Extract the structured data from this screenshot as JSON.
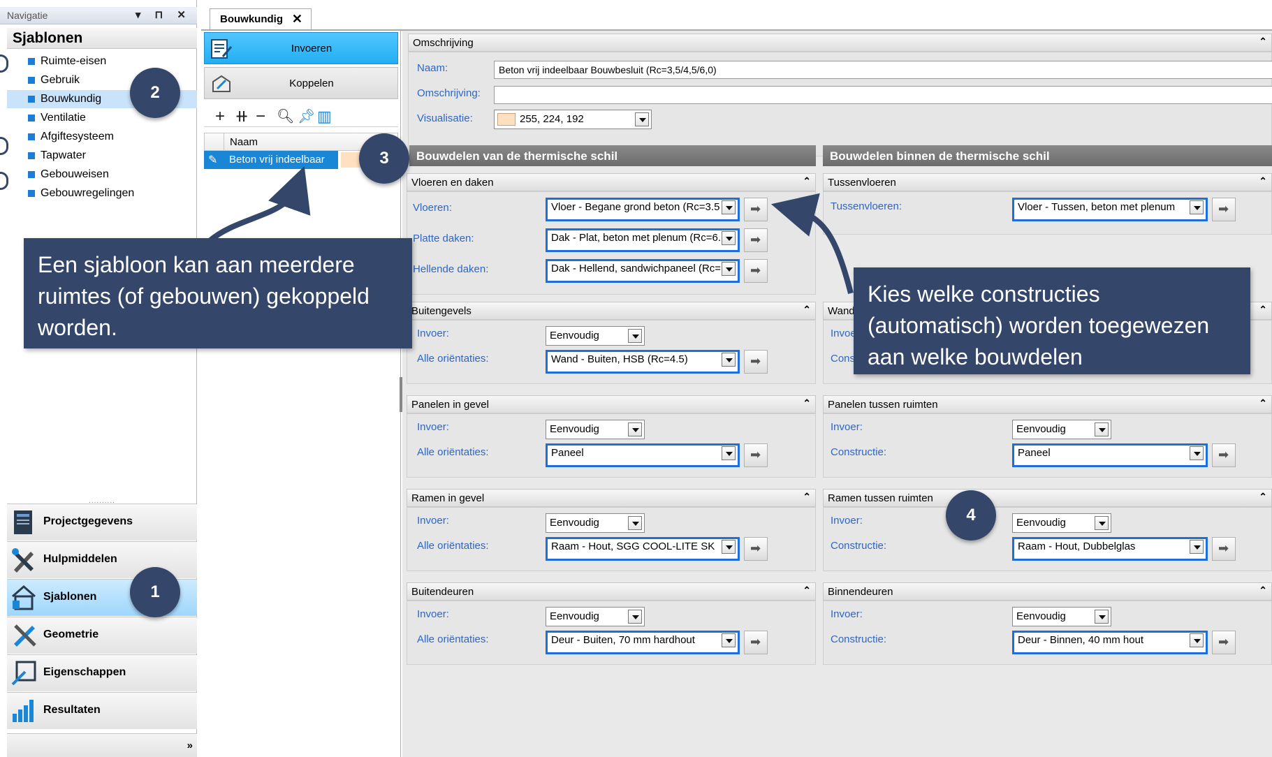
{
  "navigation": {
    "title": "Navigatie",
    "controls": "▾ ⊓ ✕",
    "section_title": "Sjablonen",
    "items": [
      {
        "label": "Ruimte-eisen"
      },
      {
        "label": "Gebruik"
      },
      {
        "label": "Bouwkundig",
        "selected": true
      },
      {
        "label": "Ventilatie"
      },
      {
        "label": "Afgiftesysteem"
      },
      {
        "label": "Tapwater"
      },
      {
        "label": "Gebouweisen"
      },
      {
        "label": "Gebouwregelingen"
      }
    ],
    "separator": "..........",
    "big_buttons": [
      {
        "label": "Projectgegevens",
        "icon": "clipboard-icon"
      },
      {
        "label": "Hulpmiddelen",
        "icon": "tools-icon"
      },
      {
        "label": "Sjablonen",
        "icon": "template-icon",
        "selected": true
      },
      {
        "label": "Geometrie",
        "icon": "geometry-icon"
      },
      {
        "label": "Eigenschappen",
        "icon": "properties-icon"
      },
      {
        "label": "Resultaten",
        "icon": "chart-icon"
      }
    ],
    "expand": "»"
  },
  "document_tab": {
    "label": "Bouwkundig",
    "close": "✕"
  },
  "middle": {
    "invoeren": "Invoeren",
    "koppelen": "Koppelen",
    "grid_header": "Naam",
    "grid_row": "Beton vrij indeelbaar",
    "toolbar_icons": [
      "add-icon",
      "add-multiple-icon",
      "remove-icon",
      "search-icon",
      "pin-icon",
      "columns-icon"
    ]
  },
  "omschrijving": {
    "title": "Omschrijving",
    "naam_label": "Naam:",
    "naam_value": "Beton vrij indeelbaar Bouwbesluit (Rc=3,5/4,5/6,0)",
    "omschrijving_label": "Omschrijving:",
    "omschrijving_value": "",
    "visualisatie_label": "Visualisatie:",
    "visualisatie_value": "255, 224, 192",
    "visualisatie_color": "#ffe0c0"
  },
  "left_column": {
    "title": "Bouwdelen van de thermische schil",
    "vloeren_daken": {
      "title": "Vloeren en daken",
      "vloeren_label": "Vloeren:",
      "vloeren_value": "Vloer - Begane grond beton (Rc=3.5",
      "platte_label": "Platte daken:",
      "platte_value": "Dak - Plat, beton met plenum (Rc=6.",
      "hellende_label": "Hellende daken:",
      "hellende_value": "Dak - Hellend, sandwichpaneel (Rc="
    },
    "buitengevels": {
      "title": "Buitengevels",
      "invoer_label": "Invoer:",
      "invoer_value": "Eenvoudig",
      "or_label": "Alle oriëntaties:",
      "or_value": "Wand - Buiten, HSB (Rc=4.5)"
    },
    "panelen": {
      "title": "Panelen in gevel",
      "invoer_label": "Invoer:",
      "invoer_value": "Eenvoudig",
      "or_label": "Alle oriëntaties:",
      "or_value": "Paneel"
    },
    "ramen": {
      "title": "Ramen in gevel",
      "invoer_label": "Invoer:",
      "invoer_value": "Eenvoudig",
      "or_label": "Alle oriëntaties:",
      "or_value": "Raam - Hout, SGG COOL-LITE SK"
    },
    "buitendeuren": {
      "title": "Buitendeuren",
      "invoer_label": "Invoer:",
      "invoer_value": "Eenvoudig",
      "or_label": "Alle oriëntaties:",
      "or_value": "Deur - Buiten, 70 mm hardhout"
    }
  },
  "right_column": {
    "title": "Bouwdelen binnen de thermische schil",
    "tussenvloeren": {
      "title": "Tussenvloeren",
      "label": "Tussenvloeren:",
      "value": "Vloer - Tussen, beton met plenum"
    },
    "wanden": {
      "title_partial": "Wande",
      "invoer_partial": "Invoe",
      "cons_partial": "Cons"
    },
    "panelen": {
      "title": "Panelen tussen ruimten",
      "invoer_label": "Invoer:",
      "invoer_value": "Eenvoudig",
      "cons_label": "Constructie:",
      "cons_value": "Paneel"
    },
    "ramen": {
      "title": "Ramen tussen ruimten",
      "invoer_label": "Invoer:",
      "invoer_value": "Eenvoudig",
      "cons_label": "Constructie:",
      "cons_value": "Raam - Hout, Dubbelglas"
    },
    "binnendeuren": {
      "title": "Binnendeuren",
      "invoer_label": "Invoer:",
      "invoer_value": "Eenvoudig",
      "cons_label": "Constructie:",
      "cons_value": "Deur - Binnen, 40 mm hout"
    }
  },
  "annotations": {
    "badge1": "1",
    "badge2": "2",
    "badge3": "3",
    "badge4": "4",
    "callout_left": "Een sjabloon kan aan meerdere ruimtes (of gebouwen) gekoppeld worden.",
    "callout_right": "Kies welke constructies (automatisch) worden toegewezen aan welke bouwdelen",
    "color": "#34466a"
  },
  "colors": {
    "accent": "#22aef3",
    "selection": "#1a86d6",
    "label_blue": "#2d66c6",
    "highlight_border": "#1c6fdc"
  }
}
